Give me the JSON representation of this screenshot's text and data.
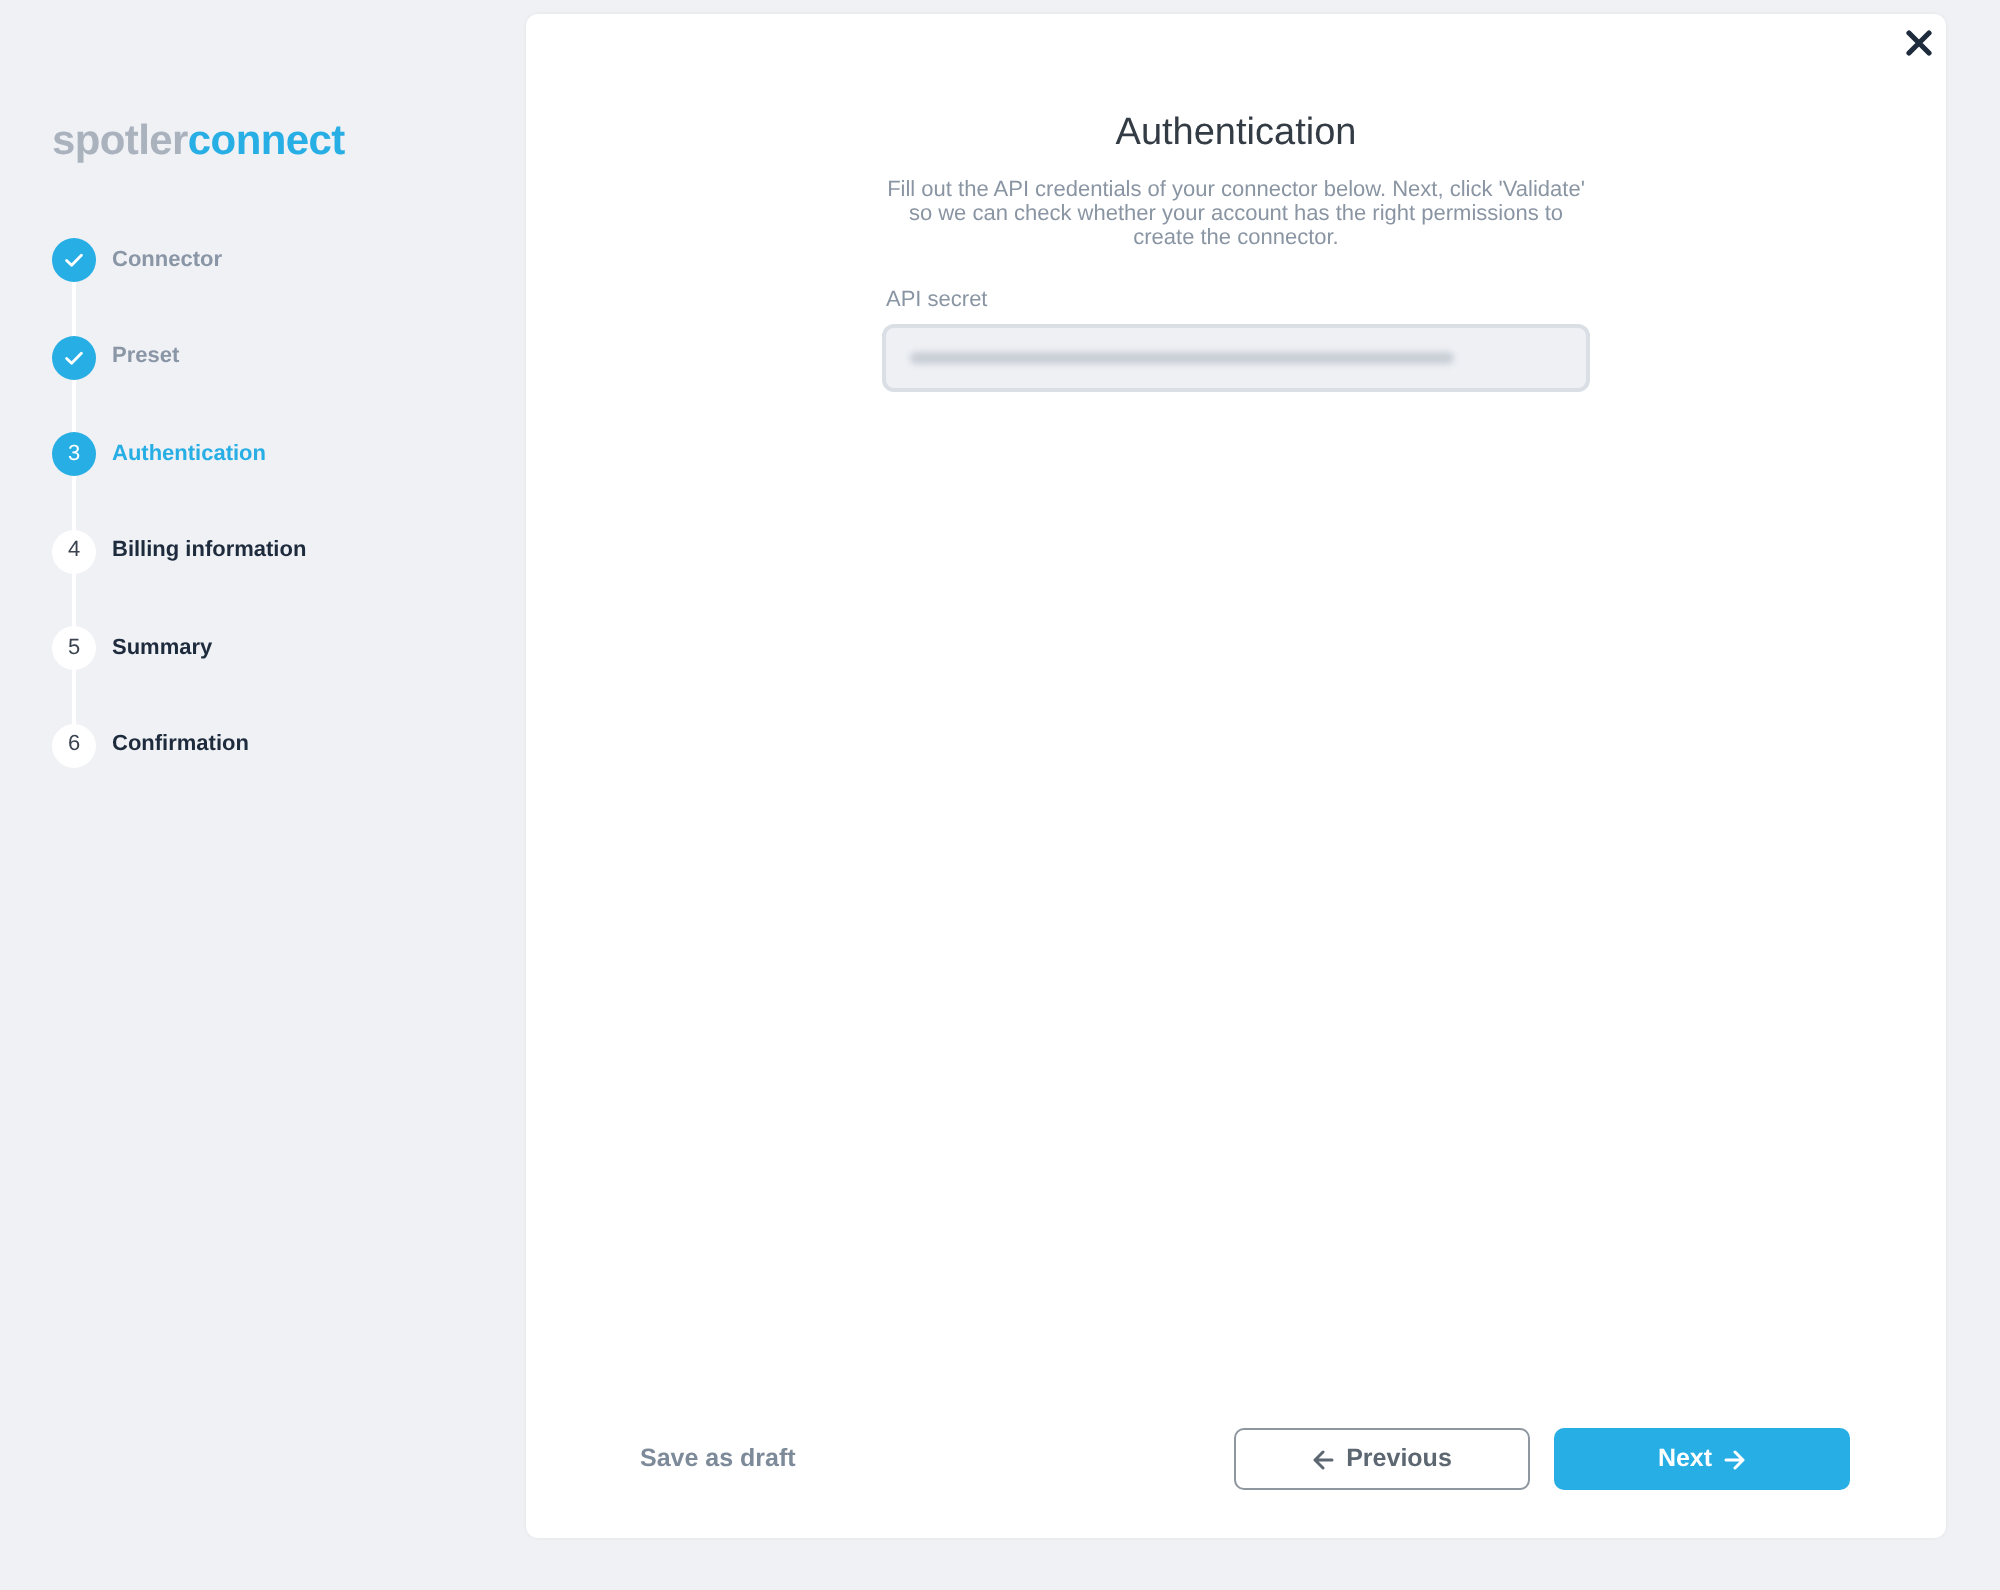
{
  "logo": {
    "part_1": "spotler",
    "part_2": "connect"
  },
  "steps": [
    {
      "label": "Connector",
      "completed": true,
      "selected": false
    },
    {
      "label": "Preset",
      "completed": true,
      "selected": false
    },
    {
      "number": "3",
      "label": "Authentication",
      "completed": false,
      "selected": true
    },
    {
      "number": "4",
      "label": "Billing information",
      "completed": false,
      "selected": false
    },
    {
      "number": "5",
      "label": "Summary",
      "completed": false,
      "selected": false
    },
    {
      "number": "6",
      "label": "Confirmation",
      "completed": false,
      "selected": false
    }
  ],
  "dialog": {
    "title": "Authentication",
    "description": "Fill out the API credentials of your connector below. Next, click 'Validate' so we can check whether your account has the right permissions to create the connector.",
    "fields": [
      {
        "label": "API secret",
        "value_blurred": true
      }
    ]
  },
  "footer": {
    "save_draft": "Save as draft",
    "previous": "Previous",
    "next": "Next"
  }
}
